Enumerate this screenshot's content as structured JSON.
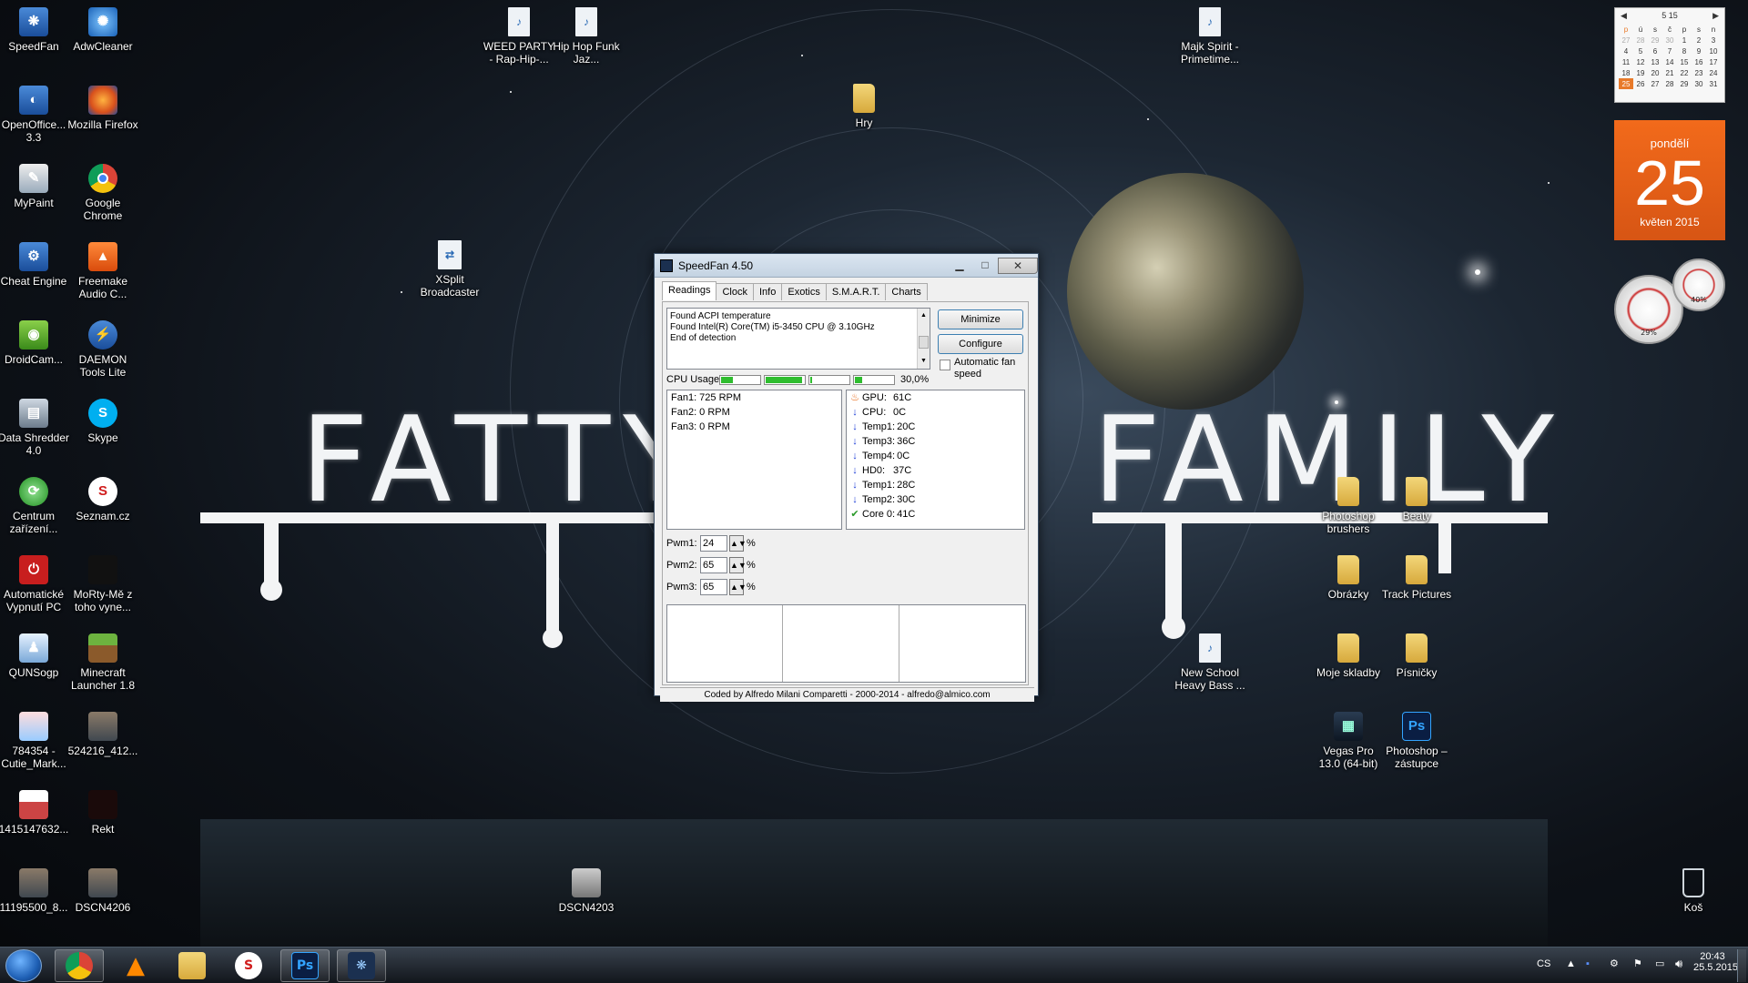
{
  "desktop": {
    "icons_left": [
      {
        "label": "SpeedFan",
        "icon": "speedfan-icon"
      },
      {
        "label": "AdwCleaner",
        "icon": "adwcleaner-icon"
      },
      {
        "label": "OpenOffice... 3.3",
        "icon": "openoffice-icon"
      },
      {
        "label": "Mozilla Firefox",
        "icon": "firefox-icon"
      },
      {
        "label": "MyPaint",
        "icon": "mypaint-icon"
      },
      {
        "label": "Google Chrome",
        "icon": "chrome-icon"
      },
      {
        "label": "Cheat Engine",
        "icon": "cheat-engine-icon"
      },
      {
        "label": "Freemake Audio C...",
        "icon": "freemake-icon"
      },
      {
        "label": "DroidCam...",
        "icon": "droidcam-icon"
      },
      {
        "label": "DAEMON Tools Lite",
        "icon": "daemon-tools-icon"
      },
      {
        "label": "Data Shredder 4.0",
        "icon": "data-shredder-icon"
      },
      {
        "label": "Skype",
        "icon": "skype-icon"
      },
      {
        "label": "Centrum zařízení...",
        "icon": "device-center-icon"
      },
      {
        "label": "Seznam.cz",
        "icon": "seznam-icon"
      },
      {
        "label": "Automatické Vypnutí PC",
        "icon": "shutdown-icon"
      },
      {
        "label": "MoRty-Mě z toho vyne...",
        "icon": "image-file-icon"
      },
      {
        "label": "QUNSogp",
        "icon": "qunsogp-icon"
      },
      {
        "label": "Minecraft Launcher 1.8",
        "icon": "minecraft-icon"
      },
      {
        "label": "784354 - Cutie_Mark...",
        "icon": "image-file-icon"
      },
      {
        "label": "524216_412...",
        "icon": "image-file-icon"
      },
      {
        "label": "1415147632...",
        "icon": "image-file-icon"
      },
      {
        "label": "Rekt",
        "icon": "image-file-icon"
      },
      {
        "label": "11195500_8...",
        "icon": "image-file-icon"
      },
      {
        "label": "DSCN4206",
        "icon": "image-file-icon"
      }
    ],
    "icons_other": [
      {
        "label": "WEED PARTY - Rap-Hip-...",
        "icon": "mp3-file-icon"
      },
      {
        "label": "Hip Hop Funk Jaz...",
        "icon": "mp3-file-icon"
      },
      {
        "label": "Majk Spirit - Primetime...",
        "icon": "mp3-file-icon"
      },
      {
        "label": "Hry",
        "icon": "folder-icon"
      },
      {
        "label": "XSplit Broadcaster",
        "icon": "xsplit-icon"
      },
      {
        "label": "Photoshop brushers",
        "icon": "folder-icon"
      },
      {
        "label": "Beaty",
        "icon": "folder-icon"
      },
      {
        "label": "Obrázky",
        "icon": "folder-icon"
      },
      {
        "label": "Track Pictures",
        "icon": "folder-icon"
      },
      {
        "label": "New School Heavy Bass ...",
        "icon": "mp3-file-icon"
      },
      {
        "label": "Moje skladby",
        "icon": "folder-icon"
      },
      {
        "label": "Písničky",
        "icon": "folder-icon"
      },
      {
        "label": "Vegas Pro 13.0 (64-bit)",
        "icon": "vegas-icon"
      },
      {
        "label": "Photoshop – zástupce",
        "icon": "photoshop-icon"
      },
      {
        "label": "DSCN4203",
        "icon": "image-file-icon"
      },
      {
        "label": "Koš",
        "icon": "recycle-bin-icon"
      }
    ],
    "wallpaper": {
      "word1": "FATTY",
      "word2": "FAMILY"
    }
  },
  "calendar_gadget": {
    "month_label": "5 15",
    "weekdays": [
      "p",
      "ú",
      "s",
      "č",
      "p",
      "s",
      "n"
    ],
    "weeks": [
      [
        "27",
        "28",
        "29",
        "30",
        "1",
        "2",
        "3"
      ],
      [
        "4",
        "5",
        "6",
        "7",
        "8",
        "9",
        "10"
      ],
      [
        "11",
        "12",
        "13",
        "14",
        "15",
        "16",
        "17"
      ],
      [
        "18",
        "19",
        "20",
        "21",
        "22",
        "23",
        "24"
      ],
      [
        "25",
        "26",
        "27",
        "28",
        "29",
        "30",
        "31"
      ]
    ],
    "day_name": "pondělí",
    "day_number": "25",
    "month_year": "květen 2015"
  },
  "cpu_gadget": {
    "cpu_percent": "29%",
    "mem_percent": "40%"
  },
  "speedfan": {
    "title": "SpeedFan 4.50",
    "tabs": [
      "Readings",
      "Clock",
      "Info",
      "Exotics",
      "S.M.A.R.T.",
      "Charts"
    ],
    "log": [
      "Found ACPI temperature",
      "Found Intel(R) Core(TM) i5-3450 CPU @ 3.10GHz",
      "End of detection"
    ],
    "buttons": {
      "minimize": "Minimize",
      "configure": "Configure"
    },
    "auto_fan_label": "Automatic fan speed",
    "cpu_usage_label": "CPU Usage",
    "cpu_usage_value": "30,0%",
    "cpu_core_loads": [
      0.3,
      0.95,
      0.05,
      0.2
    ],
    "fans": [
      "Fan1: 725 RPM",
      "Fan2: 0 RPM",
      "Fan3: 0 RPM"
    ],
    "temps": [
      {
        "label": "GPU:",
        "value": "61C",
        "trend": "hot"
      },
      {
        "label": "CPU:",
        "value": "0C",
        "trend": "down"
      },
      {
        "label": "Temp1:",
        "value": "20C",
        "trend": "down"
      },
      {
        "label": "Temp3:",
        "value": "36C",
        "trend": "down"
      },
      {
        "label": "Temp4:",
        "value": "0C",
        "trend": "down"
      },
      {
        "label": "HD0:",
        "value": "37C",
        "trend": "down"
      },
      {
        "label": "Temp1:",
        "value": "28C",
        "trend": "down"
      },
      {
        "label": "Temp2:",
        "value": "30C",
        "trend": "down"
      },
      {
        "label": "Core 0:",
        "value": "41C",
        "trend": "ok"
      }
    ],
    "pwm": [
      {
        "label": "Pwm1:",
        "value": "24",
        "unit": "%"
      },
      {
        "label": "Pwm2:",
        "value": "65",
        "unit": "%"
      },
      {
        "label": "Pwm3:",
        "value": "65",
        "unit": "%"
      }
    ],
    "footer": "Coded by Alfredo Milani Comparetti - 2000-2014 - alfredo@almico.com"
  },
  "taskbar": {
    "items": [
      {
        "name": "chrome",
        "icon": "chrome-icon",
        "open": true
      },
      {
        "name": "vlc",
        "icon": "vlc-icon",
        "open": false
      },
      {
        "name": "explorer",
        "icon": "folder-icon",
        "open": false
      },
      {
        "name": "seznam",
        "icon": "seznam-icon",
        "open": false
      },
      {
        "name": "photoshop",
        "icon": "photoshop-icon",
        "open": true
      },
      {
        "name": "speedfan",
        "icon": "speedfan-icon",
        "open": true
      }
    ],
    "language": "CS",
    "time": "20:43",
    "date": "25.5.2015"
  }
}
